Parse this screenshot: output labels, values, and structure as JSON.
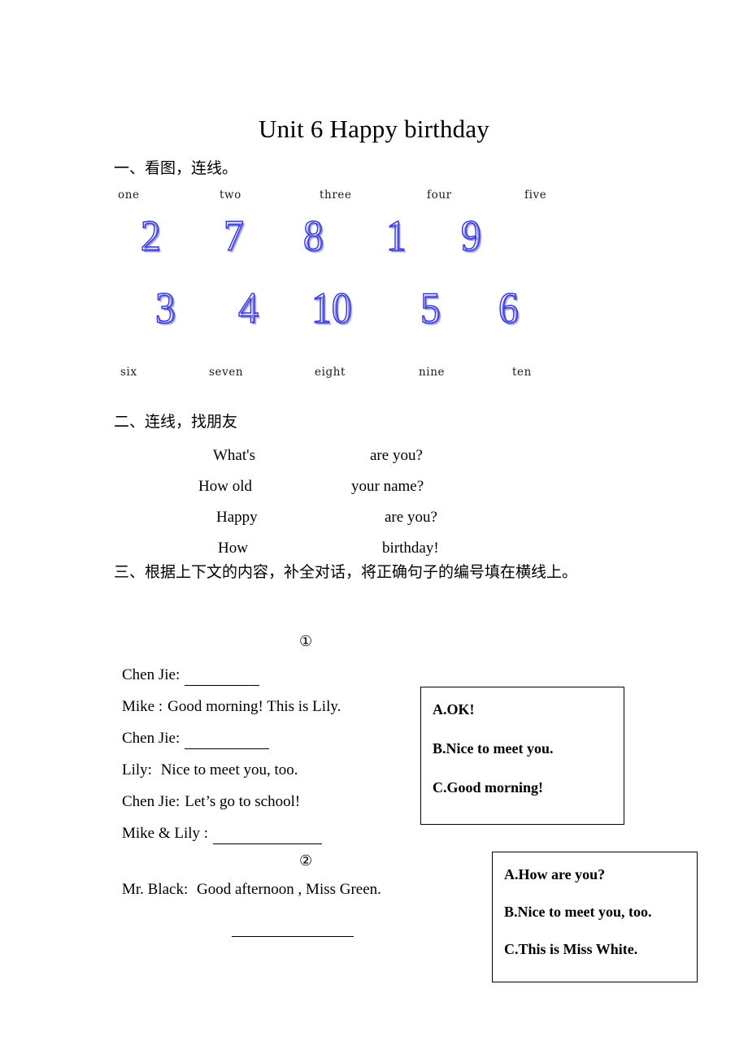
{
  "document": {
    "title": "Unit 6 Happy birthday"
  },
  "sections": {
    "one": {
      "heading": "一、看图，连线。",
      "figure": {
        "top_words": [
          "one",
          "two",
          "three",
          "four",
          "five"
        ],
        "top_digits": [
          "2",
          "7",
          "8",
          "1",
          "9"
        ],
        "bottom_digits": [
          "3",
          "4",
          "10",
          "5",
          "6"
        ],
        "bottom_words": [
          "six",
          "seven",
          "eight",
          "nine",
          "ten"
        ],
        "digit_color": "#3b3bd4",
        "digit_shadow_color": "#8282f5"
      }
    },
    "two": {
      "heading": "二、连线，找朋友",
      "pairs": [
        {
          "left": "What's",
          "right": "are you?"
        },
        {
          "left": "How old",
          "right": "your name?"
        },
        {
          "left": "Happy",
          "right": "are you?"
        },
        {
          "left": "How",
          "right": "birthday!"
        }
      ]
    },
    "three": {
      "heading": "三、根据上下文的内容，补全对话，将正确句子的编号填在横线上。",
      "dialogue_1": {
        "marker": "①",
        "lines": [
          {
            "speaker": "Chen Jie:",
            "text": "",
            "blank": "short"
          },
          {
            "speaker": "Mike    :",
            "text": "Good morning! This is Lily.",
            "blank": ""
          },
          {
            "speaker": "Chen Jie:",
            "text": "",
            "blank": "medium"
          },
          {
            "speaker": "Lily:",
            "text": "    Nice to meet you, too.",
            "blank": ""
          },
          {
            "speaker": "Chen Jie:",
            "text": "Let’s go to school!",
            "blank": ""
          },
          {
            "speaker": "Mike & Lily :",
            "text": "",
            "blank": "long"
          }
        ],
        "options": [
          "A.OK!",
          "B.Nice to meet you.",
          "C.Good morning!"
        ]
      },
      "dialogue_2": {
        "marker": "②",
        "lines": [
          {
            "speaker": "Mr. Black:",
            "text": "    Good afternoon , Miss Green.",
            "blank": ""
          }
        ],
        "answer_blank": true,
        "options": [
          "A.How are you?",
          "B.Nice to meet you, too.",
          "C.This is Miss White."
        ]
      }
    }
  }
}
